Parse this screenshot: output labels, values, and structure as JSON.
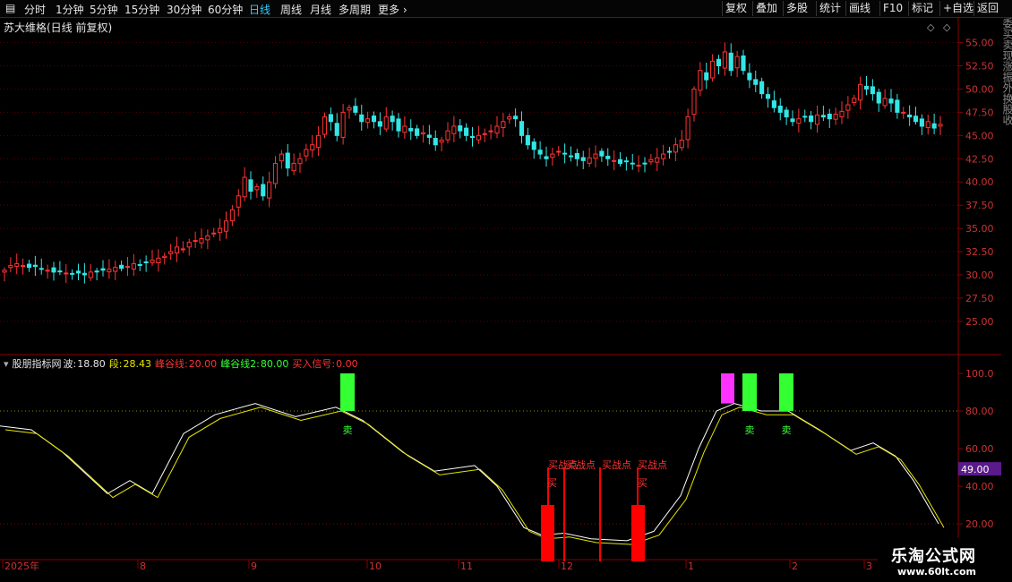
{
  "toolbar": {
    "periods": [
      "分时",
      "1分钟",
      "5分钟",
      "15分钟",
      "30分钟",
      "60分钟",
      "日线",
      "周线",
      "月线",
      "多周期",
      "更多"
    ],
    "active_period": "日线",
    "right_buttons": [
      "复权",
      "叠加",
      "多股",
      "统计",
      "画线",
      "F10",
      "标记",
      "+自选",
      "返回"
    ]
  },
  "main_chart": {
    "title": "苏大维格(日线 前复权)",
    "y_ticks": [
      "55.00",
      "52.50",
      "50.00",
      "47.50",
      "45.00",
      "42.50",
      "40.00",
      "37.50",
      "35.00",
      "32.50",
      "30.00",
      "27.50",
      "25.00"
    ],
    "y_tick_values": [
      55,
      52.5,
      50,
      47.5,
      45,
      42.5,
      40,
      37.5,
      35,
      32.5,
      30,
      27.5,
      25
    ],
    "price_range": [
      22.0,
      56.5
    ],
    "up_color": "#ff3333",
    "down_color": "#33e6e6"
  },
  "indicator": {
    "name": "股朋指标网",
    "wave_label": "波:",
    "wave_value": "18.80",
    "segment_label": "段:",
    "segment_value": "28.43",
    "valley_label": "峰谷线:",
    "valley_value": "20.00",
    "valley2_label": "峰谷线2:",
    "valley2_value": "80.00",
    "buy_signal_label": "买入信号:",
    "buy_signal_value": "0.00",
    "y_ticks": [
      "100.0",
      "80.00",
      "60.00",
      "40.00",
      "20.00"
    ],
    "y_tick_values": [
      100,
      80,
      60,
      40,
      20
    ],
    "current_value_badge": "49.00",
    "sell_label": "卖",
    "buy_label": "买",
    "buy_point_label": "买战点"
  },
  "x_axis": {
    "labels": [
      "2025年",
      "8",
      "9",
      "10",
      "11",
      "12",
      "1",
      "2",
      "3"
    ]
  },
  "side_text": [
    "委",
    "买",
    "卖",
    "现",
    "涨",
    "振",
    "外",
    "换",
    "股",
    "收"
  ],
  "logo": {
    "main": "乐淘公式网",
    "url": "www.60lt.com"
  },
  "chart_data": {
    "type": "candlestick",
    "title": "苏大维格(日线 前复权)",
    "x_labels": [
      "2025年",
      "8",
      "9",
      "10",
      "11",
      "12",
      "1",
      "2",
      "3"
    ],
    "closes": [
      30.5,
      31,
      31.2,
      31,
      30.8,
      30.9,
      30.6,
      30.5,
      30.3,
      30.4,
      30.2,
      30.1,
      30.2,
      30,
      30.3,
      30.4,
      30.5,
      30.6,
      30.8,
      30.7,
      30.9,
      31.2,
      31.1,
      31.3,
      31.6,
      31.8,
      32.0,
      32.5,
      33,
      32.8,
      33.5,
      33.7,
      33.9,
      34.2,
      34.5,
      35,
      35.8,
      37,
      38.5,
      40.5,
      39,
      39.5,
      38.5,
      40,
      42,
      43,
      41.5,
      42,
      42.5,
      43.5,
      44,
      45,
      47,
      46.5,
      45,
      47.5,
      48,
      47.5,
      46.5,
      46.8,
      46.5,
      46,
      47,
      46.5,
      45.5,
      46,
      45.5,
      45,
      45.3,
      44.8,
      44,
      44.5,
      45.5,
      46,
      45.5,
      45,
      44.8,
      45,
      45.2,
      45.5,
      46,
      46.5,
      47,
      46.8,
      45,
      44,
      43.5,
      43,
      42.5,
      43,
      43.3,
      43,
      42.8,
      42.5,
      42.3,
      42.6,
      43,
      42.8,
      42.5,
      42.3,
      42,
      42.2,
      42,
      41.8,
      42,
      42.4,
      42.6,
      43,
      43.2,
      44,
      44.5,
      47,
      50,
      52,
      51,
      53,
      52.5,
      54,
      52,
      53.5,
      52,
      51,
      50.5,
      49.5,
      49,
      48,
      47.5,
      47,
      46.5,
      46.8,
      47,
      46.5,
      47.2,
      47,
      46.8,
      47.3,
      47.6,
      48.3,
      49,
      50.5,
      50,
      49.5,
      48.5,
      49,
      48.5,
      47.5,
      47.5,
      47,
      46.5,
      46,
      46.5,
      45.8,
      46.2
    ],
    "indicator_series": [
      {
        "name": "波",
        "last_value": 18.8
      },
      {
        "name": "段",
        "last_value": 28.43
      },
      {
        "name": "峰谷线",
        "value": 20.0
      },
      {
        "name": "峰谷线2",
        "value": 80.0
      },
      {
        "name": "买入信号",
        "value": 0.0
      }
    ]
  }
}
